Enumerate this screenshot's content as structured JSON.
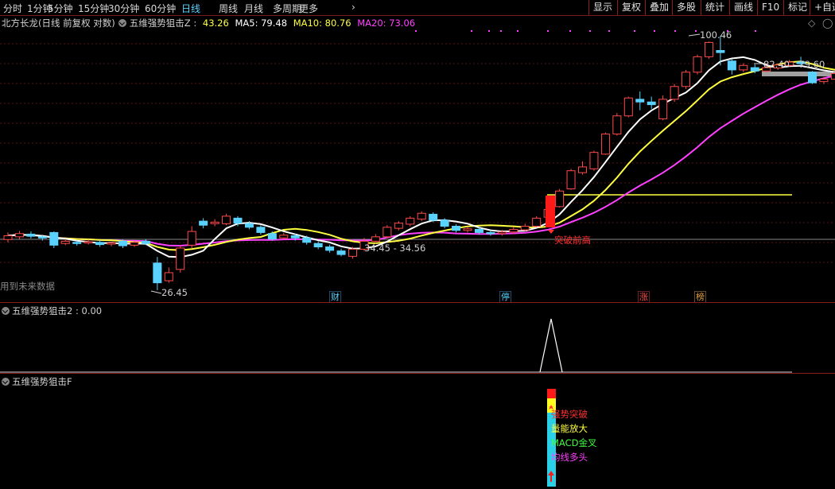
{
  "toolbar": {
    "periods": [
      "分时",
      "1分钟",
      "5分钟",
      "15分钟",
      "30分钟",
      "60分钟",
      "日线",
      "周线",
      "月线",
      "多周期",
      "更多"
    ],
    "active_period": "日线",
    "more_chevron": "›",
    "right_buttons": [
      "显示",
      "复权",
      "叠加",
      "多股",
      "统计",
      "画线",
      "F10",
      "标记",
      "+自选"
    ]
  },
  "main_panel": {
    "stock_title": "北方长龙(日线 前复权 对数)",
    "indicator_name": "五维强势狙击Z",
    "indicator_value": "43.26",
    "ma5_label": "MA5: 79.48",
    "ma10_label": "MA10: 80.76",
    "ma20_label": "MA20: 73.06",
    "high_label": "100.46",
    "low_label": "26.45",
    "range_label": "82.40 - 79.60",
    "mid_range_label": "34.45 - 34.56",
    "breakout_label": "突破前高",
    "future_data_note": "用到未来数据",
    "events": [
      {
        "text": "财",
        "color": "#5ad2ff"
      },
      {
        "text": "停",
        "color": "#5ad2ff"
      },
      {
        "text": "涨",
        "color": "#ff4a4a"
      },
      {
        "text": "榜",
        "color": "#e0a040"
      }
    ]
  },
  "panel2": {
    "title": "五维强势狙击2 : 0.00"
  },
  "panel3": {
    "title": "五维强势狙击F",
    "signals": [
      {
        "text": "强势突破",
        "color": "#ff3030"
      },
      {
        "text": "量能放大",
        "color": "#ffff40"
      },
      {
        "text": "MACD金叉",
        "color": "#40ff40"
      },
      {
        "text": "均线多头",
        "color": "#ff40ff"
      }
    ]
  },
  "colors": {
    "up": "#ff4a4a",
    "down": "#5ad2ff",
    "ma5": "#ffffff",
    "ma10": "#ffff40",
    "ma20": "#ff40ff",
    "border": "#8a1c1c"
  },
  "chart_data": {
    "type": "candlestick",
    "ma_series": [
      {
        "name": "MA5",
        "last": 79.48
      },
      {
        "name": "MA10",
        "last": 80.76
      },
      {
        "name": "MA20",
        "last": 73.06
      }
    ],
    "high": 100.46,
    "low": 26.45,
    "candles": [
      {
        "o": 34.5,
        "c": 35.2,
        "h": 35.8,
        "l": 34.0
      },
      {
        "o": 35.0,
        "c": 35.6,
        "h": 36.1,
        "l": 34.6
      },
      {
        "o": 35.5,
        "c": 35.1,
        "h": 36.0,
        "l": 34.7
      },
      {
        "o": 35.0,
        "c": 34.8,
        "h": 35.3,
        "l": 34.3
      },
      {
        "o": 35.8,
        "c": 33.5,
        "h": 36.0,
        "l": 33.0
      },
      {
        "o": 33.8,
        "c": 34.2,
        "h": 34.6,
        "l": 33.5
      },
      {
        "o": 34.0,
        "c": 33.8,
        "h": 34.3,
        "l": 33.4
      },
      {
        "o": 33.9,
        "c": 34.1,
        "h": 34.5,
        "l": 33.6
      },
      {
        "o": 34.0,
        "c": 33.6,
        "h": 34.4,
        "l": 33.2
      },
      {
        "o": 33.7,
        "c": 33.9,
        "h": 34.1,
        "l": 33.3
      },
      {
        "o": 34.2,
        "c": 33.4,
        "h": 34.5,
        "l": 33.0
      },
      {
        "o": 33.5,
        "c": 34.0,
        "h": 34.3,
        "l": 33.2
      },
      {
        "o": 34.2,
        "c": 33.8,
        "h": 34.6,
        "l": 33.5
      },
      {
        "o": 30.5,
        "c": 27.5,
        "h": 31.5,
        "l": 26.45
      },
      {
        "o": 27.8,
        "c": 29.0,
        "h": 29.8,
        "l": 27.5
      },
      {
        "o": 29.5,
        "c": 33.0,
        "h": 33.5,
        "l": 29.0
      },
      {
        "o": 33.5,
        "c": 36.0,
        "h": 37.0,
        "l": 33.0
      },
      {
        "o": 38.0,
        "c": 37.2,
        "h": 38.6,
        "l": 36.6
      },
      {
        "o": 37.5,
        "c": 37.8,
        "h": 38.4,
        "l": 37.0
      },
      {
        "o": 37.5,
        "c": 39.0,
        "h": 39.5,
        "l": 37.2
      },
      {
        "o": 38.6,
        "c": 37.6,
        "h": 39.0,
        "l": 37.0
      },
      {
        "o": 37.5,
        "c": 36.8,
        "h": 38.0,
        "l": 36.4
      },
      {
        "o": 36.8,
        "c": 35.8,
        "h": 37.2,
        "l": 35.4
      },
      {
        "o": 35.6,
        "c": 34.6,
        "h": 36.0,
        "l": 34.3
      },
      {
        "o": 34.8,
        "c": 35.3,
        "h": 35.7,
        "l": 34.5
      },
      {
        "o": 35.2,
        "c": 34.8,
        "h": 35.6,
        "l": 34.3
      },
      {
        "o": 34.8,
        "c": 34.0,
        "h": 35.2,
        "l": 33.6
      },
      {
        "o": 33.8,
        "c": 33.2,
        "h": 34.2,
        "l": 32.8
      },
      {
        "o": 33.2,
        "c": 32.6,
        "h": 33.6,
        "l": 32.2
      },
      {
        "o": 32.5,
        "c": 31.9,
        "h": 32.9,
        "l": 31.6
      },
      {
        "o": 31.6,
        "c": 32.8,
        "h": 33.2,
        "l": 31.2
      },
      {
        "o": 32.8,
        "c": 34.2,
        "h": 34.8,
        "l": 32.5
      },
      {
        "o": 34.2,
        "c": 35.0,
        "h": 35.5,
        "l": 33.8
      },
      {
        "o": 35.0,
        "c": 36.8,
        "h": 37.2,
        "l": 34.8
      },
      {
        "o": 36.6,
        "c": 37.6,
        "h": 38.0,
        "l": 36.2
      },
      {
        "o": 37.4,
        "c": 38.6,
        "h": 39.0,
        "l": 37.0
      },
      {
        "o": 38.4,
        "c": 39.6,
        "h": 40.0,
        "l": 38.0
      },
      {
        "o": 39.4,
        "c": 38.2,
        "h": 39.8,
        "l": 37.8
      },
      {
        "o": 38.2,
        "c": 37.0,
        "h": 38.6,
        "l": 36.6
      },
      {
        "o": 37.0,
        "c": 36.2,
        "h": 37.4,
        "l": 35.8
      },
      {
        "o": 36.2,
        "c": 36.5,
        "h": 36.9,
        "l": 35.8
      },
      {
        "o": 36.4,
        "c": 35.8,
        "h": 36.8,
        "l": 35.4
      },
      {
        "o": 35.8,
        "c": 35.6,
        "h": 36.2,
        "l": 35.2
      },
      {
        "o": 35.6,
        "c": 35.9,
        "h": 36.3,
        "l": 35.2
      },
      {
        "o": 35.9,
        "c": 36.4,
        "h": 36.8,
        "l": 35.5
      },
      {
        "o": 36.3,
        "c": 37.0,
        "h": 37.5,
        "l": 36.0
      },
      {
        "o": 37.0,
        "c": 38.6,
        "h": 39.0,
        "l": 36.8
      },
      {
        "o": 38.8,
        "c": 40.4,
        "h": 42.5,
        "l": 38.5
      },
      {
        "o": 41.0,
        "c": 44.5,
        "h": 45.0,
        "l": 40.8
      },
      {
        "o": 45.0,
        "c": 49.5,
        "h": 50.0,
        "l": 44.8
      },
      {
        "o": 49.0,
        "c": 50.5,
        "h": 52.0,
        "l": 48.5
      },
      {
        "o": 50.0,
        "c": 54.5,
        "h": 55.0,
        "l": 49.5
      },
      {
        "o": 54.0,
        "c": 60.0,
        "h": 60.5,
        "l": 53.8
      },
      {
        "o": 60.0,
        "c": 66.0,
        "h": 67.0,
        "l": 59.5
      },
      {
        "o": 66.0,
        "c": 72.5,
        "h": 73.0,
        "l": 65.5
      },
      {
        "o": 72.0,
        "c": 71.0,
        "h": 75.0,
        "l": 68.0
      },
      {
        "o": 71.0,
        "c": 70.0,
        "h": 73.0,
        "l": 68.5
      },
      {
        "o": 65.0,
        "c": 72.0,
        "h": 73.5,
        "l": 64.5
      },
      {
        "o": 72.0,
        "c": 77.0,
        "h": 78.0,
        "l": 71.0
      },
      {
        "o": 77.0,
        "c": 83.0,
        "h": 84.0,
        "l": 76.0
      },
      {
        "o": 83.0,
        "c": 90.0,
        "h": 91.0,
        "l": 82.0
      },
      {
        "o": 90.0,
        "c": 97.0,
        "h": 97.5,
        "l": 89.0
      },
      {
        "o": 93.0,
        "c": 92.0,
        "h": 100.46,
        "l": 86.0
      },
      {
        "o": 88.0,
        "c": 84.0,
        "h": 89.0,
        "l": 82.0
      },
      {
        "o": 84.0,
        "c": 86.0,
        "h": 87.0,
        "l": 83.0
      },
      {
        "o": 85.0,
        "c": 83.5,
        "h": 86.5,
        "l": 82.5
      },
      {
        "o": 83.5,
        "c": 85.0,
        "h": 86.0,
        "l": 82.8
      },
      {
        "o": 84.8,
        "c": 86.2,
        "h": 87.0,
        "l": 84.0
      },
      {
        "o": 86.0,
        "c": 87.5,
        "h": 88.5,
        "l": 85.5
      },
      {
        "o": 87.5,
        "c": 86.8,
        "h": 90.0,
        "l": 85.8
      },
      {
        "o": 83.0,
        "c": 78.5,
        "h": 83.5,
        "l": 78.0
      },
      {
        "o": 79.0,
        "c": 80.0,
        "h": 81.0,
        "l": 78.0
      },
      {
        "o": 80.0,
        "c": 82.4,
        "h": 83.0,
        "l": 79.6
      }
    ]
  }
}
